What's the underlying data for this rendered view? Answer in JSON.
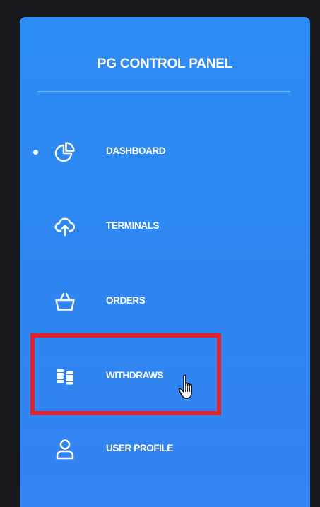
{
  "panel": {
    "title": "PG CONTROL PANEL"
  },
  "nav": {
    "items": [
      {
        "label": "DASHBOARD",
        "icon": "pie-chart-icon",
        "active": true
      },
      {
        "label": "TERMINALS",
        "icon": "cloud-upload-icon",
        "active": false
      },
      {
        "label": "ORDERS",
        "icon": "basket-icon",
        "active": false
      },
      {
        "label": "WITHDRAWS",
        "icon": "coins-icon",
        "active": false,
        "highlighted": true
      },
      {
        "label": "USER PROFILE",
        "icon": "user-icon",
        "active": false
      }
    ]
  },
  "colors": {
    "sidebar_bg": "#2f88f2",
    "page_bg": "#17191c",
    "text": "#ffffff",
    "highlight": "#e3232b"
  }
}
